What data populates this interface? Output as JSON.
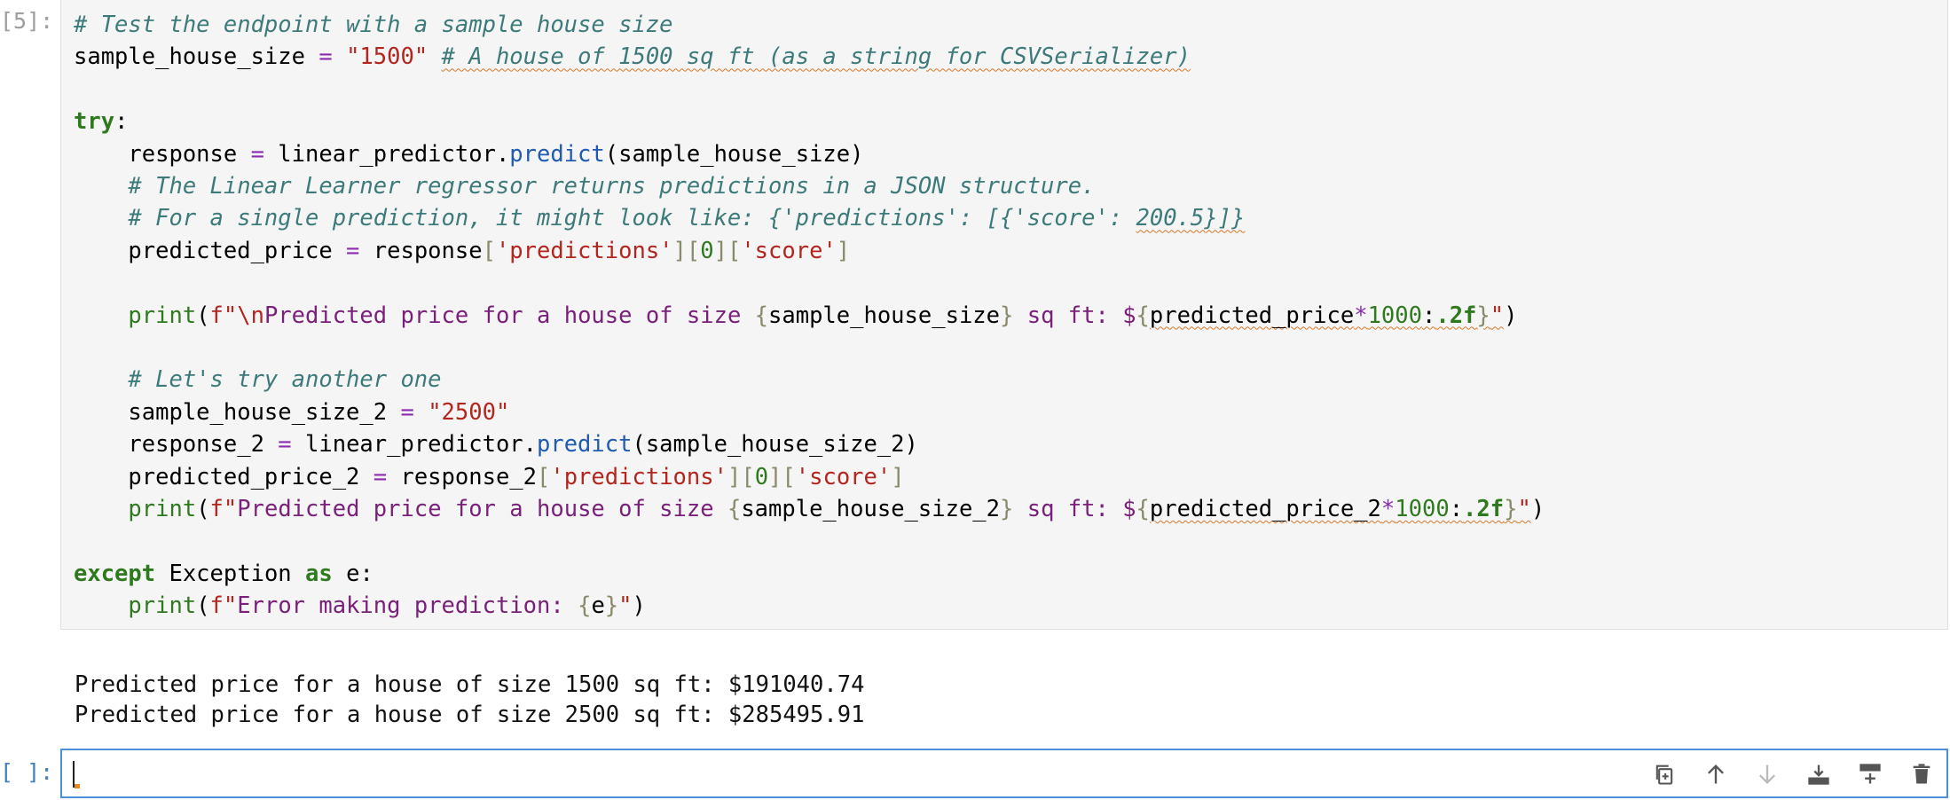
{
  "cells": {
    "code_prompt": "[5]:",
    "code_lines": [
      [
        {
          "t": "# Test the endpoint with a sample house size",
          "c": "cm"
        }
      ],
      [
        {
          "t": "sample_house_size ",
          "c": "pt"
        },
        {
          "t": "=",
          "c": "op"
        },
        {
          "t": " ",
          "c": "pt"
        },
        {
          "t": "\"1500\"",
          "c": "st"
        },
        {
          "t": " ",
          "c": "pt"
        },
        {
          "t": "# A house of 1500 sq ft (as a string for CSVSerializer)",
          "c": "cm sq"
        }
      ],
      [],
      [
        {
          "t": "try",
          "c": "kw"
        },
        {
          "t": ":",
          "c": "pt"
        }
      ],
      [
        {
          "t": "    response ",
          "c": "pt"
        },
        {
          "t": "=",
          "c": "op"
        },
        {
          "t": " linear_predictor.",
          "c": "pt"
        },
        {
          "t": "predict",
          "c": "fn"
        },
        {
          "t": "(sample_house_size)",
          "c": "pt"
        }
      ],
      [
        {
          "t": "    # The Linear Learner regressor returns predictions in a JSON structure.",
          "c": "cm"
        }
      ],
      [
        {
          "t": "    # For a single prediction, it might look like: {'predictions': [{'score': ",
          "c": "cm"
        },
        {
          "t": "200.5}]}",
          "c": "cm sq"
        }
      ],
      [
        {
          "t": "    predicted_price ",
          "c": "pt"
        },
        {
          "t": "=",
          "c": "op"
        },
        {
          "t": " response",
          "c": "pt"
        },
        {
          "t": "[",
          "c": "br"
        },
        {
          "t": "'predictions'",
          "c": "st"
        },
        {
          "t": "][",
          "c": "br"
        },
        {
          "t": "0",
          "c": "nm"
        },
        {
          "t": "][",
          "c": "br"
        },
        {
          "t": "'score'",
          "c": "st"
        },
        {
          "t": "]",
          "c": "br"
        }
      ],
      [],
      [
        {
          "t": "    ",
          "c": "pt"
        },
        {
          "t": "print",
          "c": "bi"
        },
        {
          "t": "(",
          "c": "pt"
        },
        {
          "t": "f\"\\n",
          "c": "st"
        },
        {
          "t": "Predicted price for a house of size ",
          "c": "sf"
        },
        {
          "t": "{",
          "c": "br"
        },
        {
          "t": "sample_house_size",
          "c": "pt"
        },
        {
          "t": "}",
          "c": "br"
        },
        {
          "t": " sq ft: $",
          "c": "sf"
        },
        {
          "t": "{",
          "c": "br"
        },
        {
          "t": "predicted_price",
          "c": "pt sq"
        },
        {
          "t": "*",
          "c": "op sq"
        },
        {
          "t": "1000",
          "c": "nm sq"
        },
        {
          "t": ":",
          "c": "pt sq"
        },
        {
          "t": ".2f",
          "c": "kw sq"
        },
        {
          "t": "}",
          "c": "br sq"
        },
        {
          "t": "\"",
          "c": "st sq"
        },
        {
          "t": ")",
          "c": "pt"
        }
      ],
      [],
      [
        {
          "t": "    # Let's try another one",
          "c": "cm"
        }
      ],
      [
        {
          "t": "    sample_house_size_2 ",
          "c": "pt"
        },
        {
          "t": "=",
          "c": "op"
        },
        {
          "t": " ",
          "c": "pt"
        },
        {
          "t": "\"2500\"",
          "c": "st"
        }
      ],
      [
        {
          "t": "    response_2 ",
          "c": "pt"
        },
        {
          "t": "=",
          "c": "op"
        },
        {
          "t": " linear_predictor.",
          "c": "pt"
        },
        {
          "t": "predict",
          "c": "fn"
        },
        {
          "t": "(sample_house_size_2)",
          "c": "pt"
        }
      ],
      [
        {
          "t": "    predicted_price_2 ",
          "c": "pt"
        },
        {
          "t": "=",
          "c": "op"
        },
        {
          "t": " response_2",
          "c": "pt"
        },
        {
          "t": "[",
          "c": "br"
        },
        {
          "t": "'predictions'",
          "c": "st"
        },
        {
          "t": "][",
          "c": "br"
        },
        {
          "t": "0",
          "c": "nm"
        },
        {
          "t": "][",
          "c": "br"
        },
        {
          "t": "'score'",
          "c": "st"
        },
        {
          "t": "]",
          "c": "br"
        }
      ],
      [
        {
          "t": "    ",
          "c": "pt"
        },
        {
          "t": "print",
          "c": "bi"
        },
        {
          "t": "(",
          "c": "pt"
        },
        {
          "t": "f\"",
          "c": "st"
        },
        {
          "t": "Predicted price for a house of size ",
          "c": "sf"
        },
        {
          "t": "{",
          "c": "br"
        },
        {
          "t": "sample_house_size_2",
          "c": "pt"
        },
        {
          "t": "}",
          "c": "br"
        },
        {
          "t": " sq ft: $",
          "c": "sf"
        },
        {
          "t": "{",
          "c": "br"
        },
        {
          "t": "predicted_price_2",
          "c": "pt sq"
        },
        {
          "t": "*",
          "c": "op sq"
        },
        {
          "t": "1000",
          "c": "nm sq"
        },
        {
          "t": ":",
          "c": "pt sq"
        },
        {
          "t": ".2f",
          "c": "kw sq"
        },
        {
          "t": "}",
          "c": "br sq"
        },
        {
          "t": "\"",
          "c": "st sq"
        },
        {
          "t": ")",
          "c": "pt"
        }
      ],
      [],
      [
        {
          "t": "except",
          "c": "kw"
        },
        {
          "t": " Exception ",
          "c": "pt"
        },
        {
          "t": "as",
          "c": "kw"
        },
        {
          "t": " e:",
          "c": "pt"
        }
      ],
      [
        {
          "t": "    ",
          "c": "pt"
        },
        {
          "t": "print",
          "c": "bi"
        },
        {
          "t": "(",
          "c": "pt"
        },
        {
          "t": "f\"",
          "c": "st"
        },
        {
          "t": "Error making prediction: ",
          "c": "sf"
        },
        {
          "t": "{",
          "c": "br"
        },
        {
          "t": "e",
          "c": "pt"
        },
        {
          "t": "}",
          "c": "br"
        },
        {
          "t": "\"",
          "c": "st"
        },
        {
          "t": ")",
          "c": "pt"
        }
      ]
    ],
    "output_lines": [
      "Predicted price for a house of size 1500 sq ft: $191040.74",
      "Predicted price for a house of size 2500 sq ft: $285495.91"
    ],
    "empty_prompt": "[ ]:"
  },
  "toolbar": {
    "icons": [
      "duplicate-cell-icon",
      "move-up-icon",
      "move-down-icon",
      "insert-above-icon",
      "insert-below-icon",
      "delete-cell-icon"
    ]
  },
  "colors": {
    "accent": "#4a90d9",
    "cursor_mark": "#e08a2a"
  }
}
